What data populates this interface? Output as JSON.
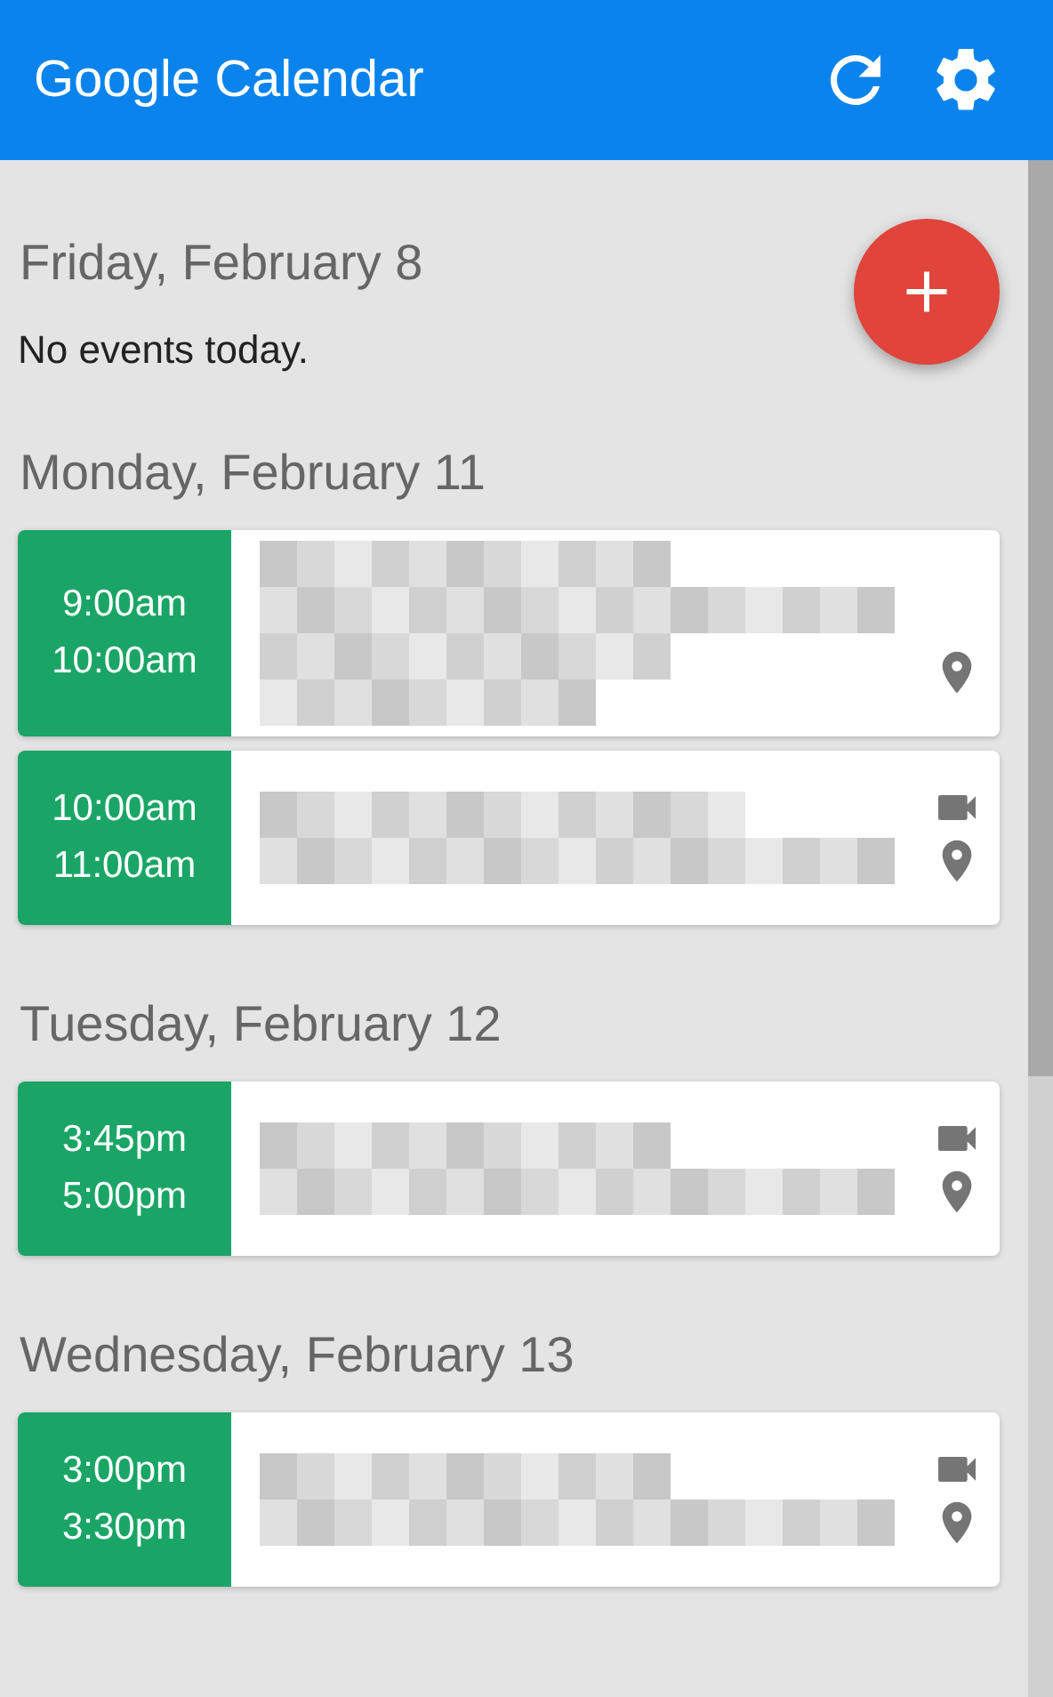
{
  "header": {
    "title": "Google Calendar"
  },
  "days": [
    {
      "date": "Friday, February 8",
      "empty_text": "No events today."
    },
    {
      "date": "Monday, February 11",
      "events": [
        {
          "start": "9:00am",
          "end": "10:00am",
          "details": {
            "kind": "blurred-long"
          },
          "video": false,
          "location": true
        },
        {
          "start": "10:00am",
          "end": "11:00am",
          "details": {
            "kind": "blurred-short"
          },
          "video": true,
          "location": true
        }
      ]
    },
    {
      "date": "Tuesday, February 12",
      "events": [
        {
          "start": "3:45pm",
          "end": "5:00pm",
          "details": {
            "kind": "blurred-short"
          },
          "video": true,
          "location": true
        }
      ]
    },
    {
      "date": "Wednesday, February 13",
      "events": [
        {
          "start": "3:00pm",
          "end": "3:30pm",
          "details": {
            "kind": "blurred-short"
          },
          "video": true,
          "location": true
        }
      ]
    }
  ]
}
